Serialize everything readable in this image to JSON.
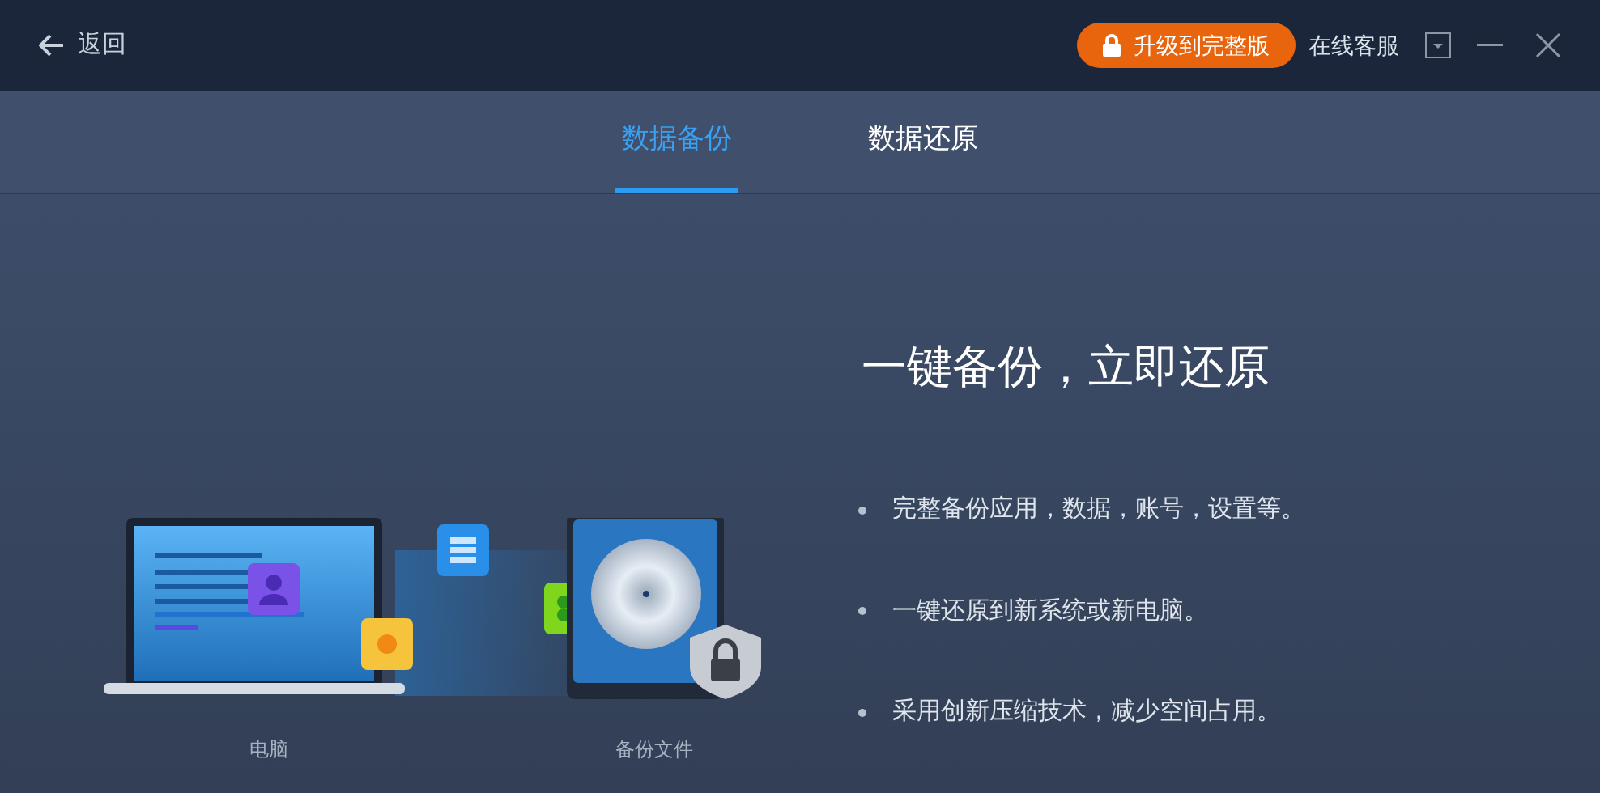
{
  "header": {
    "back": "返回",
    "upgrade": "升级到完整版",
    "support": "在线客服"
  },
  "tabs": [
    {
      "label": "数据备份",
      "selected": true
    },
    {
      "label": "数据还原",
      "selected": false
    }
  ],
  "headline": "一键备份，立即还原",
  "features": [
    "完整备份应用，数据，账号，设置等。",
    "一键还原到新系统或新电脑。",
    "采用创新压缩技术，减少空间占用。"
  ],
  "illustration": {
    "source_label": "电脑",
    "target_label": "备份文件"
  }
}
